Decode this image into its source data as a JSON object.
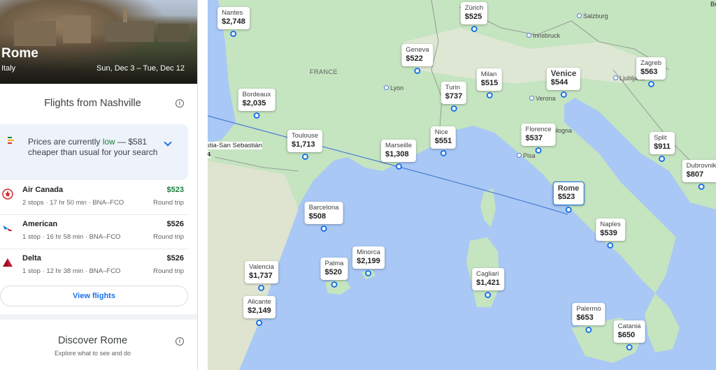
{
  "destination": {
    "name": "Rome",
    "country": "Italy",
    "dates": "Sun, Dec 3 – Tue, Dec 12"
  },
  "flights_panel": {
    "title": "Flights from Nashville",
    "insight_text_pre": "Prices are currently ",
    "insight_level": "low",
    "insight_text_post": " — $581 cheaper than usual for your search",
    "view_button": "View flights",
    "flights": [
      {
        "airline": "Air Canada",
        "detail": "2 stops · 17 hr 50 min · BNA–FCO",
        "price": "$523",
        "trip": "Round trip",
        "logo": "air-canada-logo"
      },
      {
        "airline": "American",
        "detail": "1 stop · 16 hr 58 min · BNA–FCO",
        "price": "$526",
        "trip": "Round trip",
        "logo": "american-logo"
      },
      {
        "airline": "Delta",
        "detail": "1 stop · 12 hr 38 min · BNA–FCO",
        "price": "$526",
        "trip": "Round trip",
        "logo": "delta-logo"
      }
    ]
  },
  "discover": {
    "title": "Discover Rome",
    "subtitle": "Explore what to see and do"
  },
  "map": {
    "region_labels": [
      "FRANCE"
    ],
    "place_labels": [
      "Lyon",
      "Verona",
      "Pisa",
      "Salzburg",
      "Innsbruck",
      "Ljubljana",
      "Bologna"
    ],
    "cut_labels": [
      "stia-San Sebastián",
      "4",
      "Bu",
      "Dubrovnik"
    ],
    "price_pins": [
      {
        "city": "Nantes",
        "price": "$2,748"
      },
      {
        "city": "Zürich",
        "price": "$525"
      },
      {
        "city": "Geneva",
        "price": "$522"
      },
      {
        "city": "Milan",
        "price": "$515"
      },
      {
        "city": "Venice",
        "price": "$544"
      },
      {
        "city": "Zagreb",
        "price": "$563"
      },
      {
        "city": "Turin",
        "price": "$737"
      },
      {
        "city": "Bordeaux",
        "price": "$2,035"
      },
      {
        "city": "Toulouse",
        "price": "$1,713"
      },
      {
        "city": "Nice",
        "price": "$551"
      },
      {
        "city": "Florence",
        "price": "$537"
      },
      {
        "city": "Split",
        "price": "$911"
      },
      {
        "city": "Marseille",
        "price": "$1,308"
      },
      {
        "city": "Rome",
        "price": "$523"
      },
      {
        "city": "Barcelona",
        "price": "$508"
      },
      {
        "city": "Naples",
        "price": "$539"
      },
      {
        "city": "Minorca",
        "price": "$2,199"
      },
      {
        "city": "Palma",
        "price": "$520"
      },
      {
        "city": "Valencia",
        "price": "$1,737"
      },
      {
        "city": "Cagliari",
        "price": "$1,421"
      },
      {
        "city": "Alicante",
        "price": "$2,149"
      },
      {
        "city": "Palermo",
        "price": "$653"
      },
      {
        "city": "Catania",
        "price": "$650"
      },
      {
        "city": "",
        "price": "$807"
      }
    ]
  },
  "colors": {
    "accent": "#1a73e8",
    "low_price": "#188038",
    "sea": "#a9c8f5",
    "land": "#c5e4c0"
  }
}
